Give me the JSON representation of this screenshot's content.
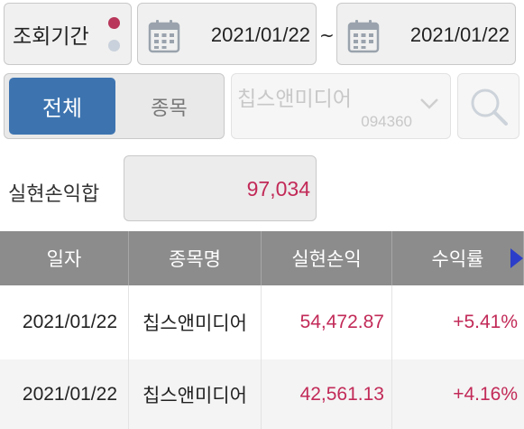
{
  "filter": {
    "period_label": "조회기간",
    "date_from": "2021/01/22",
    "date_sep": "~",
    "date_to": "2021/01/22"
  },
  "segment": {
    "all_label": "전체",
    "stock_label": "종목"
  },
  "stock": {
    "name": "칩스앤미디어",
    "code": "094360"
  },
  "summary": {
    "label": "실현손익합",
    "value": "97,034"
  },
  "table": {
    "headers": [
      "일자",
      "종목명",
      "실현손익",
      "수익률"
    ],
    "rows": [
      {
        "date": "2021/01/22",
        "name": "칩스앤미디어",
        "pnl": "54,472.87",
        "rate": "+5.41%"
      },
      {
        "date": "2021/01/22",
        "name": "칩스앤미디어",
        "pnl": "42,561.13",
        "rate": "+4.16%"
      }
    ]
  },
  "colors": {
    "accent": "#3d74b0",
    "profit": "#c22a58",
    "header_bg": "#8c8c8c",
    "dot_active": "#b8375a",
    "dot_inactive": "#c9d1dc",
    "calendar_icon": "#9aa3ad",
    "arrow": "#2c3ec9"
  },
  "icons": {
    "calendar": "calendar-icon",
    "search": "search-icon",
    "dropdown": "chevron-down-icon",
    "scroll": "caret-right-icon"
  }
}
